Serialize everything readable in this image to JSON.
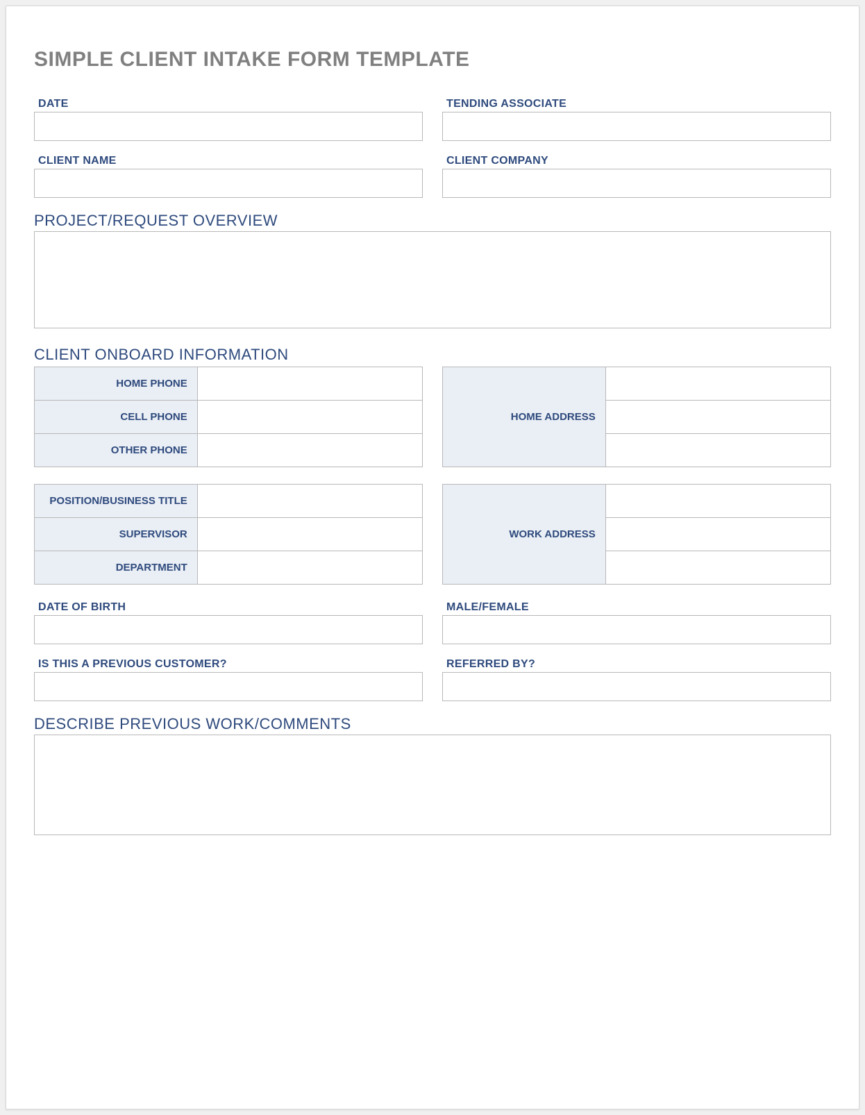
{
  "title": "SIMPLE CLIENT INTAKE FORM TEMPLATE",
  "fields": {
    "date_label": "DATE",
    "date_value": "",
    "tending_associate_label": "TENDING ASSOCIATE",
    "tending_associate_value": "",
    "client_name_label": "CLIENT NAME",
    "client_name_value": "",
    "client_company_label": "CLIENT COMPANY",
    "client_company_value": "",
    "project_overview_label": "PROJECT/REQUEST OVERVIEW",
    "project_overview_value": "",
    "onboard_section_label": "CLIENT ONBOARD INFORMATION",
    "home_phone_label": "HOME PHONE",
    "home_phone_value": "",
    "cell_phone_label": "CELL PHONE",
    "cell_phone_value": "",
    "other_phone_label": "OTHER PHONE",
    "other_phone_value": "",
    "home_address_label": "HOME ADDRESS",
    "home_address_value": "",
    "position_title_label": "POSITION/BUSINESS TITLE",
    "position_title_value": "",
    "supervisor_label": "SUPERVISOR",
    "supervisor_value": "",
    "department_label": "DEPARTMENT",
    "department_value": "",
    "work_address_label": "WORK ADDRESS",
    "work_address_value": "",
    "dob_label": "DATE OF BIRTH",
    "dob_value": "",
    "gender_label": "MALE/FEMALE",
    "gender_value": "",
    "prev_customer_label": "IS THIS A PREVIOUS CUSTOMER?",
    "prev_customer_value": "",
    "referred_by_label": "REFERRED BY?",
    "referred_by_value": "",
    "previous_work_label": "DESCRIBE PREVIOUS WORK/COMMENTS",
    "previous_work_value": ""
  }
}
